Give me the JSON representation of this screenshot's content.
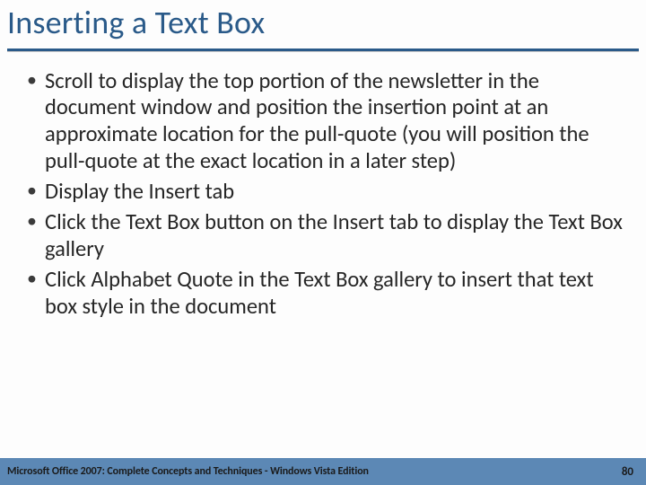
{
  "title": "Inserting a Text Box",
  "bullets": [
    "Scroll to display the top portion of the newsletter in the document window and position the insertion point at an approximate location for the pull-quote (you will position the pull-quote at the exact location in a later step)",
    "Display the Insert tab",
    "Click the Text Box button on the Insert tab to display the Text Box gallery",
    "Click Alphabet Quote in the Text Box gallery to insert that text box style in the document"
  ],
  "footer": {
    "text": "Microsoft Office 2007: Complete Concepts and Techniques - Windows Vista Edition",
    "page": "80"
  }
}
